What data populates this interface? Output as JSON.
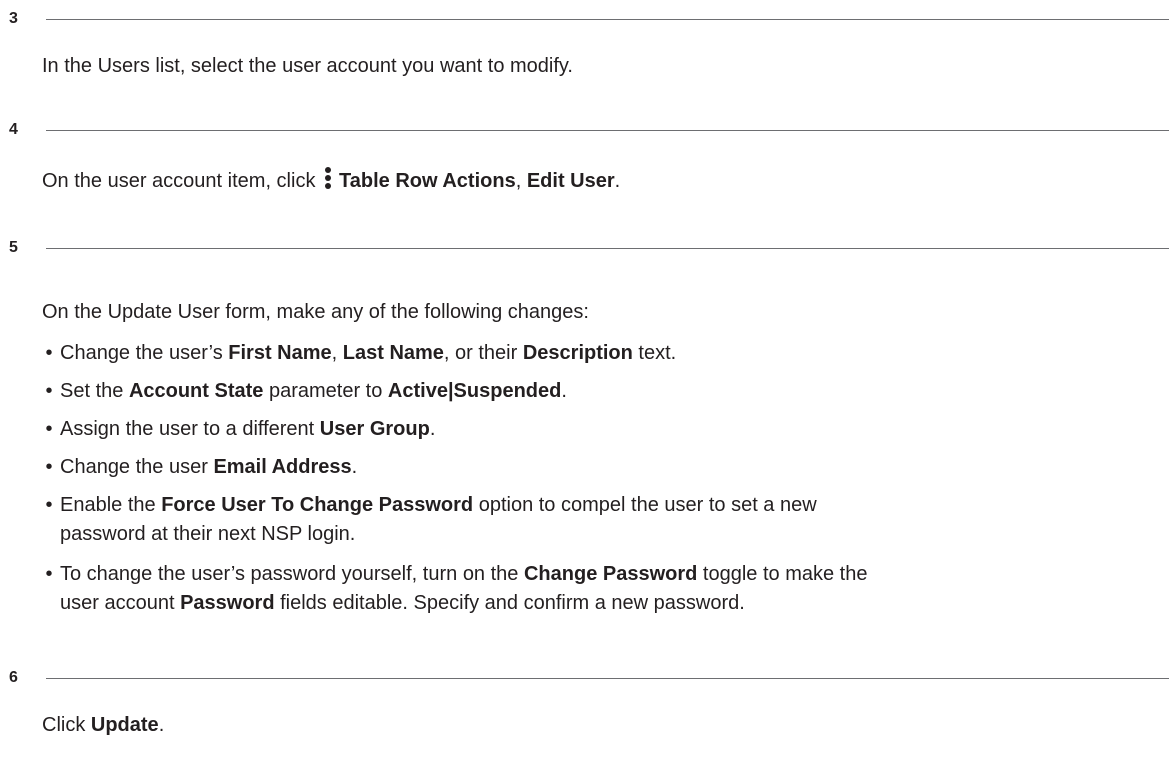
{
  "steps": [
    {
      "number": "3",
      "text": "In the Users list, select the user account you want to modify."
    },
    {
      "number": "4",
      "prefix": "On the user account item, click ",
      "action1": "Table Row Actions",
      "sep": ", ",
      "action2": "Edit User",
      "suffix": ".",
      "icon": "kebab-more-vertical-icon"
    },
    {
      "number": "5",
      "intro": "On the Update User form, make any of the following changes:",
      "bullet_glyph": "•",
      "bullets": [
        {
          "t1": "Change the user’s ",
          "b1": "First Name",
          "t2": ", ",
          "b2": "Last Name",
          "t3": ", or their ",
          "b3": "Description",
          "t4": " text."
        },
        {
          "t1": "Set the ",
          "b1": "Account State",
          "t2": " parameter to ",
          "b2": "Active|Suspended",
          "t3": "."
        },
        {
          "t1": "Assign the user to a different ",
          "b1": "User Group",
          "t2": "."
        },
        {
          "t1": "Change the user ",
          "b1": "Email Address",
          "t2": "."
        },
        {
          "t1": "Enable the ",
          "b1": "Force User To Change Password",
          "t2": " option to compel the user to set a new",
          "line2": "password at their next NSP login."
        },
        {
          "t1": "To change the user’s password yourself, turn on the ",
          "b1": "Change Password",
          "t2": " toggle to make the",
          "l2a": "user account ",
          "l2b": "Password",
          "l2c": " fields editable. Specify and confirm a new password."
        }
      ]
    },
    {
      "number": "6",
      "prefix": "Click ",
      "action": "Update",
      "suffix": "."
    }
  ]
}
